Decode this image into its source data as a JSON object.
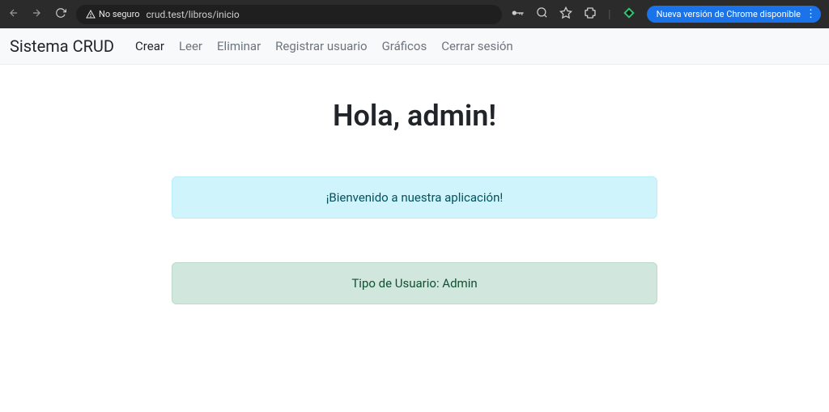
{
  "browser": {
    "insecure_label": "No seguro",
    "url": "crud.test/libros/inicio",
    "update_label": "Nueva versión de Chrome disponible"
  },
  "navbar": {
    "brand": "Sistema CRUD",
    "links": {
      "crear": "Crear",
      "leer": "Leer",
      "eliminar": "Eliminar",
      "registrar": "Registrar usuario",
      "graficos": "Gráficos",
      "cerrar": "Cerrar sesión"
    }
  },
  "main": {
    "heading": "Hola, admin!",
    "welcome_alert": "¡Bienvenido a nuestra aplicación!",
    "usertype_alert": "Tipo de Usuario: Admin"
  }
}
